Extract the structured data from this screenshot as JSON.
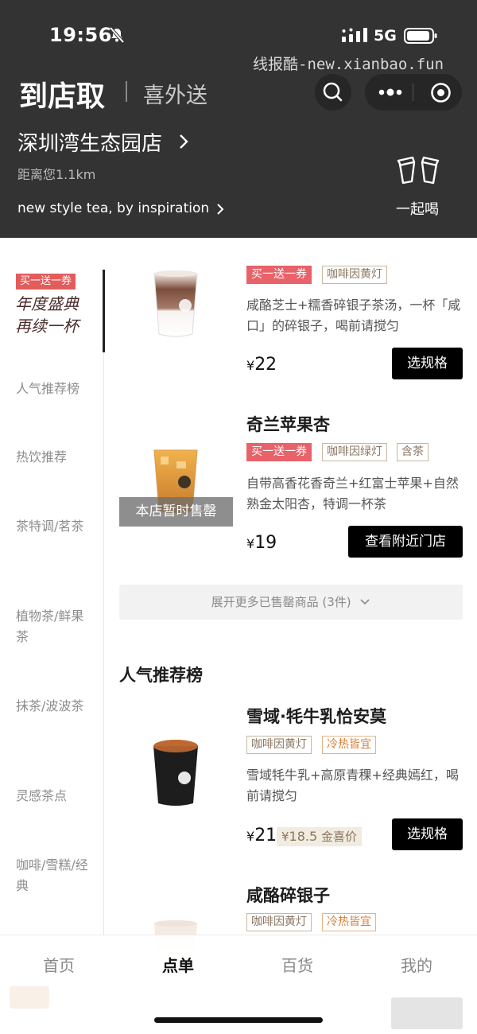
{
  "status_bar": {
    "time": "19:56",
    "network": "5G",
    "watermark": "线报酷-new.xianbao.fun"
  },
  "header": {
    "mode_active": "到店取",
    "mode_other": "喜外送",
    "store_name": "深圳湾生态园店",
    "store_distance": "距离您1.1km",
    "slogan": "new style tea, by inspiration",
    "drink_together": "一起喝"
  },
  "sidebar": {
    "promo_tag": "买一送一券",
    "promo_handwriting": [
      "年度盛典",
      "再续一杯"
    ],
    "items": [
      "人气推荐榜",
      "热饮推荐",
      "茶特调/茗茶",
      "植物茶/鲜果茶",
      "抹茶/波波茶",
      "灵感茶点",
      "咖啡/雪糕/经典"
    ]
  },
  "products": [
    {
      "tags": [
        "买一送一券",
        "咖啡因黄灯"
      ],
      "desc": "咸酪芝士+糯香碎银子茶汤，一杯「咸口」的碎银子，喝前请搅匀",
      "price": "22",
      "button": "选规格"
    },
    {
      "title": "奇兰苹果杏",
      "tags": [
        "买一送一券",
        "咖啡因绿灯",
        "含茶"
      ],
      "desc": "自带高香花香奇兰+红富士苹果+自然熟金太阳杏，特调一杯茶",
      "price": "19",
      "soldout": "本店暂时售罄",
      "button": "查看附近门店"
    },
    {
      "title": "雪域·牦牛乳恰安莫",
      "tags": [
        "咖啡因黄灯",
        "冷热皆宜"
      ],
      "desc": "雪域牦牛乳+高原青稞+经典嫣红，喝前请搅匀",
      "price": "21",
      "member_price": "18.5",
      "member_label": "金喜价",
      "button": "选规格"
    },
    {
      "title": "咸酪碎银子",
      "tags": [
        "咖啡因黄灯",
        "冷热皆宜"
      ]
    }
  ],
  "currency": "¥",
  "expand_soldout": "展开更多已售罄商品 (3件)",
  "section_title": "人气推荐榜",
  "tabbar": {
    "items": [
      "首页",
      "点单",
      "百货",
      "我的"
    ],
    "active": "点单"
  },
  "colors": {
    "header_bg": "#333333",
    "promo_red": "#e8626a",
    "black_button": "#000000"
  }
}
